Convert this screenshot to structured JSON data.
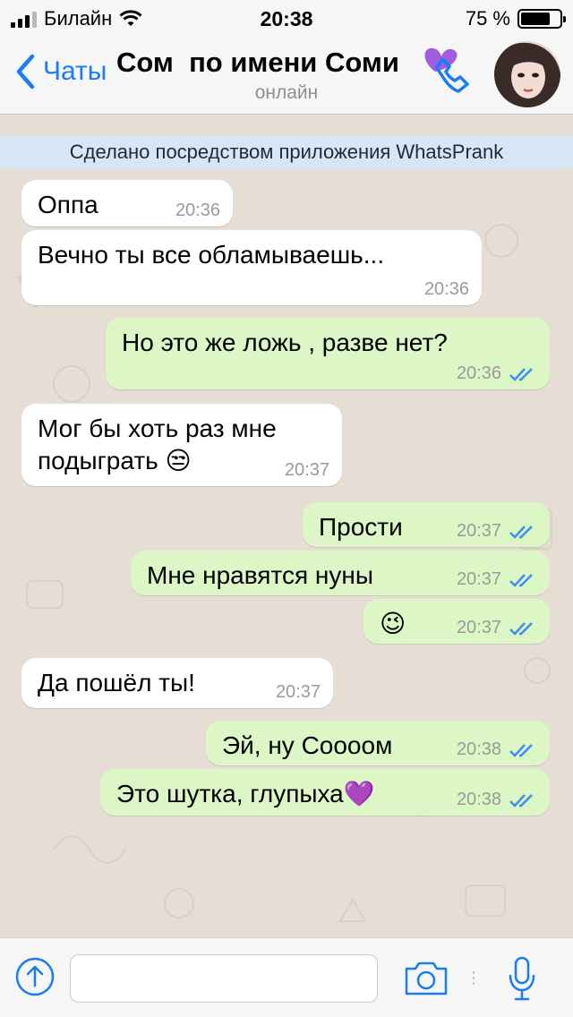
{
  "status_bar": {
    "carrier": "Билайн",
    "time": "20:38",
    "battery_percent": "75 %",
    "battery_level": 0.75
  },
  "header": {
    "back_label": "Чаты",
    "contact_name": "Сом  по имени Соми",
    "status": "онлайн"
  },
  "banner": "Сделано посредством приложения WhatsPrank",
  "messages": [
    {
      "dir": "in",
      "text": "Оппа",
      "time": "20:36"
    },
    {
      "dir": "in",
      "text": "Вечно ты все обламываешь...",
      "time": "20:36"
    },
    {
      "dir": "out",
      "text": "Но это же ложь , разве нет?",
      "time": "20:36",
      "read": true
    },
    {
      "dir": "in",
      "text": "Мог бы хоть раз мне\nподыграть 😒",
      "time": "20:37"
    },
    {
      "dir": "out",
      "text": "Прости",
      "time": "20:37",
      "read": true
    },
    {
      "dir": "out",
      "text": "Мне нравятся нуны",
      "time": "20:37",
      "read": true
    },
    {
      "dir": "out",
      "text": "😉",
      "time": "20:37",
      "read": true
    },
    {
      "dir": "in",
      "text": "Да пошёл ты!",
      "time": "20:37"
    },
    {
      "dir": "out",
      "text": "Эй, ну Соооом",
      "time": "20:38",
      "read": true
    },
    {
      "dir": "out",
      "text": "Это шутка, глупыха💜",
      "time": "20:38",
      "read": true
    }
  ],
  "icons": {
    "back": "chevron-left-icon",
    "call": "purple-heart-phone-icon",
    "attach": "arrow-up-circle-icon",
    "camera": "camera-icon",
    "mic": "microphone-icon",
    "read_receipt": "double-check-icon"
  },
  "colors": {
    "accent": "#1a7cf5",
    "incoming_bubble": "#ffffff",
    "outgoing_bubble": "#dcf7c5",
    "chat_background": "#e6ddd4",
    "banner": "#d7e6f5",
    "check_blue": "#3b8ff3"
  },
  "input": {
    "value": "",
    "placeholder": ""
  }
}
